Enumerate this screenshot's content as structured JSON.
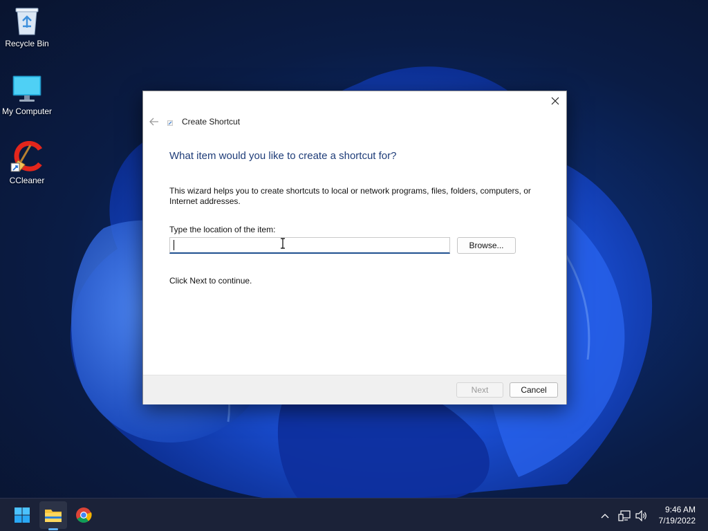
{
  "desktop": {
    "icons": [
      {
        "label": "Recycle Bin",
        "icon": "recycle-bin-icon"
      },
      {
        "label": "My Computer",
        "icon": "monitor-icon"
      },
      {
        "label": "CCleaner",
        "icon": "ccleaner-icon"
      }
    ]
  },
  "dialog": {
    "title": "Create Shortcut",
    "heading": "What item would you like to create a shortcut for?",
    "description": "This wizard helps you to create shortcuts to local or network programs, files, folders, computers, or Internet addresses.",
    "location_label": "Type the location of the item:",
    "location_value": "",
    "browse_label": "Browse...",
    "hint": "Click Next to continue.",
    "next_label": "Next",
    "cancel_label": "Cancel",
    "next_enabled": false
  },
  "taskbar": {
    "apps": [
      "start-icon",
      "file-explorer-icon",
      "chrome-icon"
    ],
    "tray": [
      "chevron-up-icon",
      "network-icon",
      "volume-icon"
    ],
    "time": "9:46 AM",
    "date": "7/19/2022"
  },
  "colors": {
    "heading": "#1e3c78",
    "input_underline": "#1e4f8f",
    "taskbar": "#1b2238",
    "accent": "#0078d4"
  }
}
